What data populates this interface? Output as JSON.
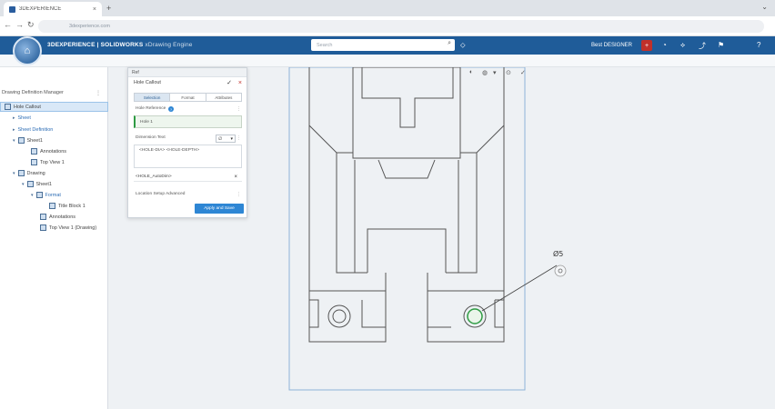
{
  "browser": {
    "tab_title": "3DEXPERIENCE",
    "close_icon": "×",
    "new_tab_icon": "+",
    "window_controls": "⌄",
    "nav": {
      "back": "←",
      "forward": "→",
      "reload": "↻"
    },
    "url": "3dexperience.com"
  },
  "app_header": {
    "logo_icon": "compass-icon",
    "brand_bold": "3DEXPERIENCE | SOLIDWORKS",
    "brand_app": "xDrawing Engine",
    "search_placeholder": "Search",
    "search_icon": "⌕",
    "user_name": "Best DESIGNER",
    "user_badge": "+",
    "header_icons": [
      "share-icon",
      "plus-icon",
      "network-icon",
      "bookmark-icon",
      "help-icon"
    ],
    "header_icon_glyphs": [
      "◔",
      "⟡",
      "⤴",
      "⚑",
      "?"
    ]
  },
  "tree": {
    "title": "Drawing Definition Manager",
    "more_icon": "⋮",
    "rows": [
      {
        "label": "Hole Callout",
        "level": 0,
        "selected": true
      },
      {
        "label": "Sheet",
        "level": 1,
        "blue": true
      },
      {
        "label": "Sheet Definition",
        "level": 1,
        "blue": true
      },
      {
        "label": "Sheet1",
        "level": 2
      },
      {
        "label": "Annotations",
        "level": 3
      },
      {
        "label": "Top View 1",
        "level": 3
      },
      {
        "label": "Drawing",
        "level": 2
      },
      {
        "label": "Sheet1",
        "level": 3
      },
      {
        "label": "Format",
        "level": 4,
        "blue": true
      },
      {
        "label": "Title Block 1",
        "level": 5
      },
      {
        "label": "Annotations",
        "level": 4
      },
      {
        "label": "Top View 1 (Drawing)",
        "level": 4
      }
    ]
  },
  "dialog": {
    "tab_label": "Ref",
    "title": "Hole Callout",
    "ok_icon": "✓",
    "cancel_icon": "×",
    "tabs": [
      "Selection",
      "Format",
      "Attributes"
    ],
    "entity_label": "Hole Reference",
    "help": "?",
    "more_icon": "⋮",
    "field_value": "Hole 1",
    "dimension_label": "Dimension Text",
    "combo_value": "∅",
    "combo_caret": "▾",
    "text_value": "<HOLE-DIA> <HOLE-DEPTH>",
    "sub_item": "<HOLE_AutoDim>",
    "sub_item_close": "×",
    "bottom_label": "Location Setup Advanced",
    "apply_button": "Apply and Save"
  },
  "canvas": {
    "callout_text": "Ø5",
    "view_toolbar": [
      "◐",
      "◍",
      "▾",
      "⊙",
      "✓"
    ]
  }
}
